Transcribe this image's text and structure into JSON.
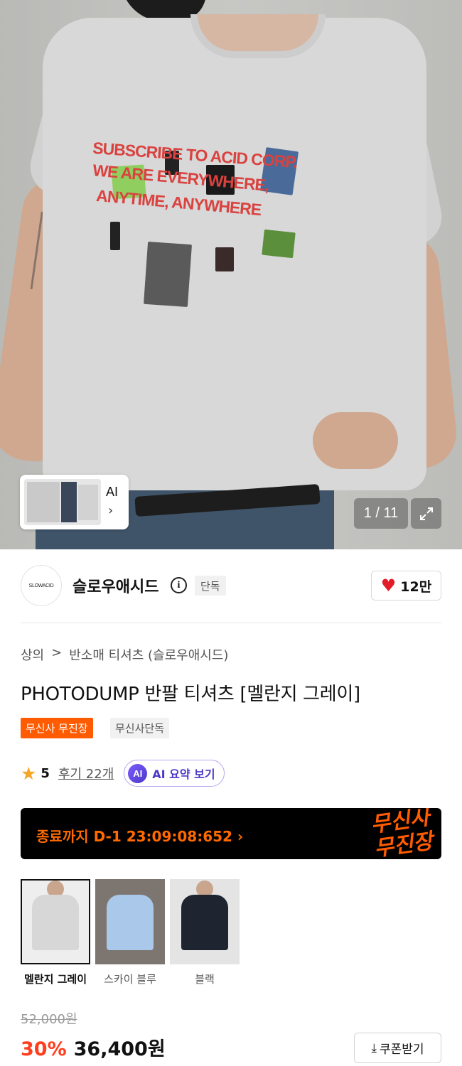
{
  "hero": {
    "print_lines": [
      "SUBSCRIBE TO ACID CORP.",
      "WE ARE EVERYWHERE,",
      "ANYTIME, ANYWHERE"
    ],
    "ai_thumb_label": "AI",
    "ai_thumb_chevron": "›",
    "image_counter": "1 / 11",
    "expand_icon": "expand-icon"
  },
  "brand": {
    "logo_text": "SLOWACID",
    "name": "슬로우애시드",
    "info_icon": "i",
    "exclusive_tag": "단독",
    "likes": "12만"
  },
  "product": {
    "breadcrumb": [
      "상의",
      ">",
      "반소매 티셔츠 (슬로우애시드)"
    ],
    "title": "PHOTODUMP 반팔 티셔츠 [멜란지 그레이]",
    "badge_event": "무신사 무진장",
    "badge_exclusive": "무신사단독",
    "rating": "5",
    "reviews": "후기 22개",
    "ai_summary_icon": "AI",
    "ai_summary": "AI 요약 보기"
  },
  "banner": {
    "timer": "종료까지 D-1 23:09:08:652  ›",
    "logo_line1": "무신사",
    "logo_line2": "무진장"
  },
  "colors": [
    {
      "label": "멜란지 그레이",
      "selected": true,
      "swatch": "#d7d7d7",
      "bg": "#eeeeee"
    },
    {
      "label": "스카이 블루",
      "selected": false,
      "swatch": "#a9c8ea",
      "bg": "#7d7570"
    },
    {
      "label": "블랙",
      "selected": false,
      "swatch": "#1f2530",
      "bg": "#e4e4e4"
    }
  ],
  "price": {
    "original": "52,000원",
    "discount": "30%",
    "current": "36,400원",
    "coupon": "쿠폰받기",
    "coupon_icon": "⤓"
  },
  "accent_colors": {
    "orange": "#ff5b00",
    "heart": "#e31c2a",
    "discount": "#ff3e1d",
    "ai_purple": "#4b39c8"
  }
}
